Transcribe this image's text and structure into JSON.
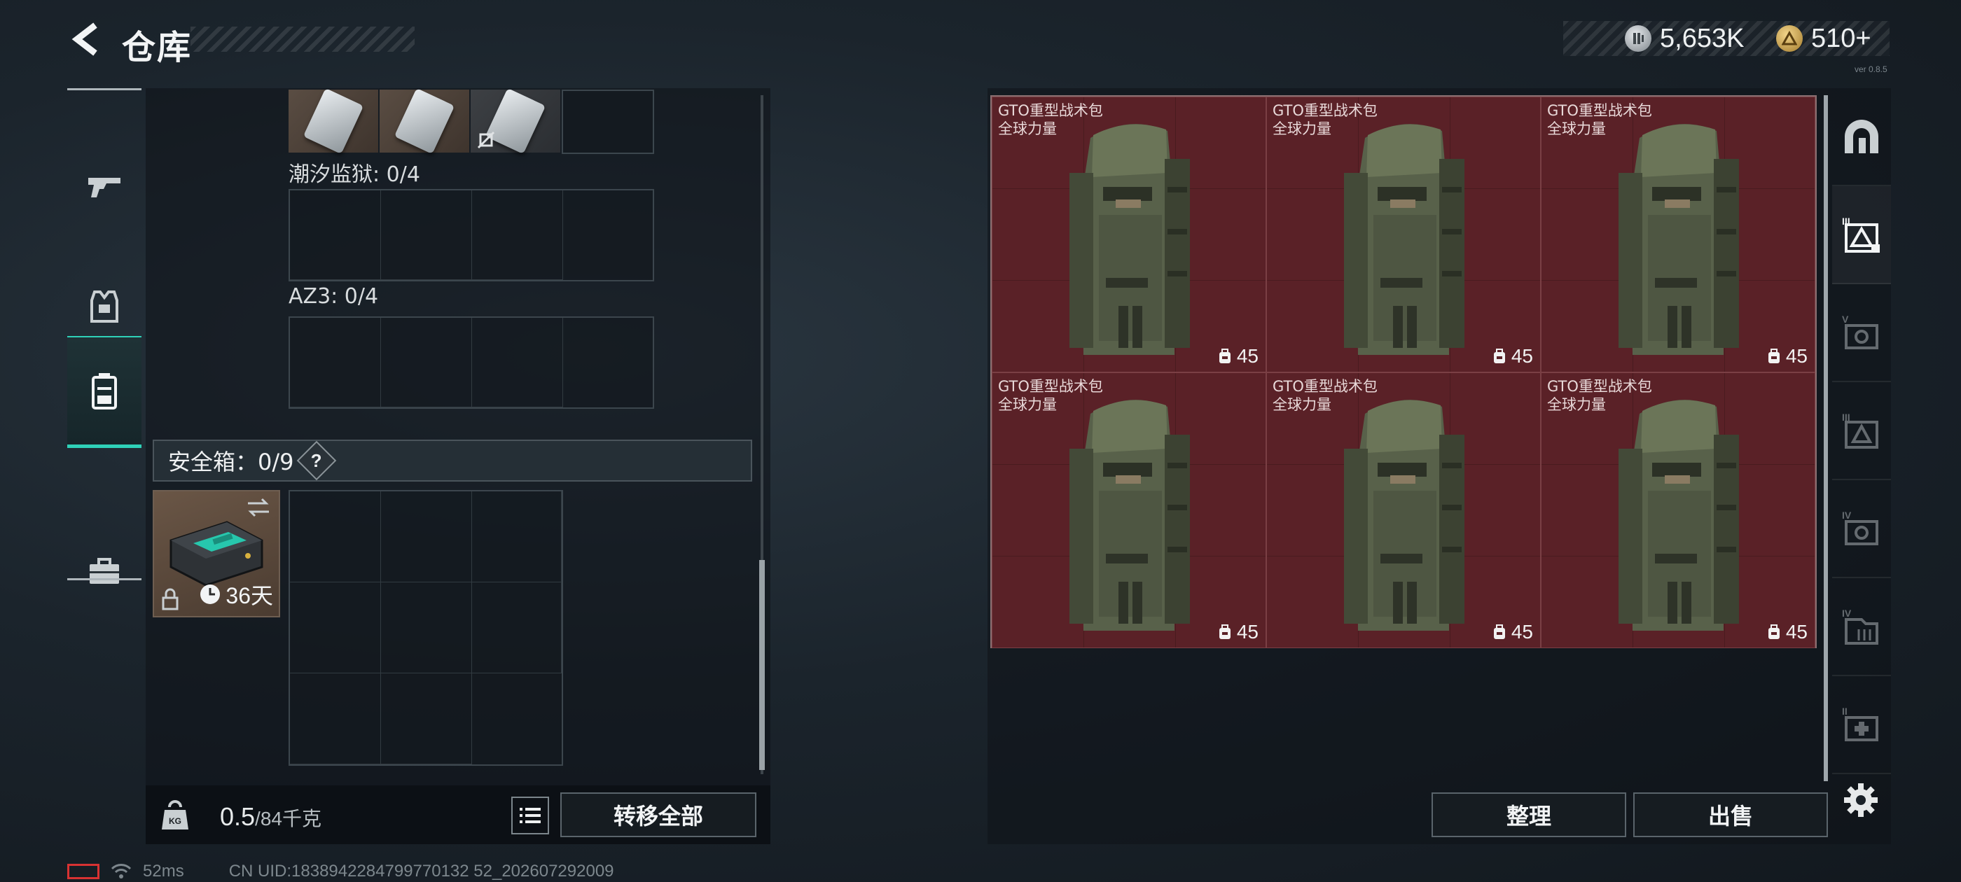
{
  "header": {
    "title": "仓库",
    "currency": [
      {
        "icon": "silver-coin-icon",
        "amount": "5,653K"
      },
      {
        "icon": "gold-coin-icon",
        "amount": "510+"
      }
    ],
    "version": "ver 0.8.5"
  },
  "left_nav": [
    {
      "name": "weapons",
      "icon": "gun-icon",
      "active": false
    },
    {
      "name": "armor",
      "icon": "vest-icon",
      "active": false
    },
    {
      "name": "backpack",
      "icon": "backpack-icon",
      "active": true
    },
    {
      "name": "medical",
      "icon": "toolbox-icon",
      "active": false
    }
  ],
  "containers": {
    "keycards_count": 3,
    "tide_prison": {
      "label": "潮汐监狱: 0/4"
    },
    "az3": {
      "label": "AZ3: 0/4"
    }
  },
  "safebox": {
    "label": "安全箱：0/9",
    "help": "?",
    "days": "36天"
  },
  "weight": {
    "current": "0.5",
    "capacity": "/84千克",
    "kg_label": "KG"
  },
  "buttons": {
    "transfer_all": "转移全部",
    "tidy": "整理",
    "sell": "出售"
  },
  "items": [
    {
      "name": "GTO重型战术包",
      "sub": "全球力量",
      "count": "45"
    },
    {
      "name": "GTO重型战术包",
      "sub": "全球力量",
      "count": "45"
    },
    {
      "name": "GTO重型战术包",
      "sub": "全球力量",
      "count": "45"
    },
    {
      "name": "GTO重型战术包",
      "sub": "全球力量",
      "count": "45"
    },
    {
      "name": "GTO重型战术包",
      "sub": "全球力量",
      "count": "45"
    },
    {
      "name": "GTO重型战术包",
      "sub": "全球力量",
      "count": "45"
    }
  ],
  "right_nav": [
    {
      "name": "all",
      "icon": "arch-icon",
      "tier": ""
    },
    {
      "name": "tier-6-backpack",
      "icon": "bag-tier-icon",
      "tier": "III"
    },
    {
      "name": "tier-5",
      "icon": "vest-tier-icon",
      "tier": "V"
    },
    {
      "name": "tier-3",
      "icon": "bag-tier-icon",
      "tier": "III"
    },
    {
      "name": "tier-4",
      "icon": "vest-tier-icon",
      "tier": "IV"
    },
    {
      "name": "tier-4b",
      "icon": "rig-tier-icon",
      "tier": "IV"
    },
    {
      "name": "tier-2",
      "icon": "medkit-tier-icon",
      "tier": "II"
    }
  ],
  "status": {
    "ping": "52ms",
    "uid": "CN UID:1838942284799770132 52_202607292009"
  },
  "colors": {
    "accent": "#2fd1b8",
    "item_bg": "#5a2127",
    "panel_bg": "#0e1318"
  }
}
